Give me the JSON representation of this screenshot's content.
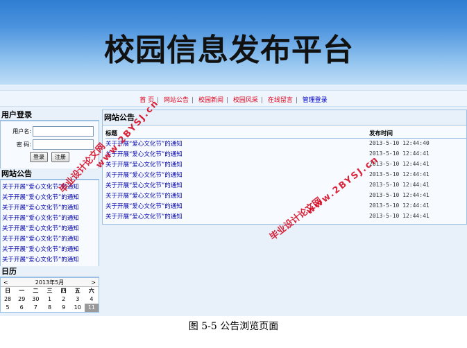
{
  "banner": {
    "title": "校园信息发布平台"
  },
  "nav": {
    "items": [
      {
        "label": "首  页"
      },
      {
        "label": "网站公告"
      },
      {
        "label": "校园新闻"
      },
      {
        "label": "校园风采"
      },
      {
        "label": "在线留言"
      },
      {
        "label": "管理登录"
      }
    ],
    "separator": "|"
  },
  "login": {
    "title": "用户登录",
    "username_label": "用户名:",
    "password_label": "密  码:",
    "username_value": "",
    "password_value": "",
    "login_button": "登录",
    "register_button": "注册"
  },
  "sidebar_notices": {
    "title": "网站公告",
    "items": [
      "关于开展“爱心文化节”的通知",
      "关于开展“爱心文化节”的通知",
      "关于开展“爱心文化节”的通知",
      "关于开展“爱心文化节”的通知",
      "关于开展“爱心文化节”的通知",
      "关于开展“爱心文化节”的通知",
      "关于开展“爱心文化节”的通知",
      "关于开展“爱心文化节”的通知"
    ]
  },
  "calendar": {
    "title": "日历",
    "prev": "<",
    "next": ">",
    "month_label": "2013年5月",
    "weekdays": [
      "日",
      "一",
      "二",
      "三",
      "四",
      "五",
      "六"
    ],
    "days": [
      "28",
      "29",
      "30",
      "1",
      "2",
      "3",
      "4",
      "5",
      "6",
      "7",
      "8",
      "9",
      "10",
      "11"
    ],
    "today": "11"
  },
  "main": {
    "title": "网站公告",
    "col_title": "标题",
    "col_time": "发布时间",
    "rows": [
      {
        "title": "关于开展“爱心文化节”的通知",
        "time": "2013-5-10 12:44:40"
      },
      {
        "title": "关于开展“爱心文化节”的通知",
        "time": "2013-5-10 12:44:41"
      },
      {
        "title": "关于开展“爱心文化节”的通知",
        "time": "2013-5-10 12:44:41"
      },
      {
        "title": "关于开展“爱心文化节”的通知",
        "time": "2013-5-10 12:44:41"
      },
      {
        "title": "关于开展“爱心文化节”的通知",
        "time": "2013-5-10 12:44:41"
      },
      {
        "title": "关于开展“爱心文化节”的通知",
        "time": "2013-5-10 12:44:41"
      },
      {
        "title": "关于开展“爱心文化节”的通知",
        "time": "2013-5-10 12:44:41"
      },
      {
        "title": "关于开展“爱心文化节”的通知",
        "time": "2013-5-10 12:44:41"
      }
    ]
  },
  "watermarks": [
    "毕业设计论文网",
    "www.2BYSJ.cn",
    "毕业设计论文网",
    "www.2BYSJ.cn"
  ],
  "caption": "图 5-5 公告浏览页面"
}
